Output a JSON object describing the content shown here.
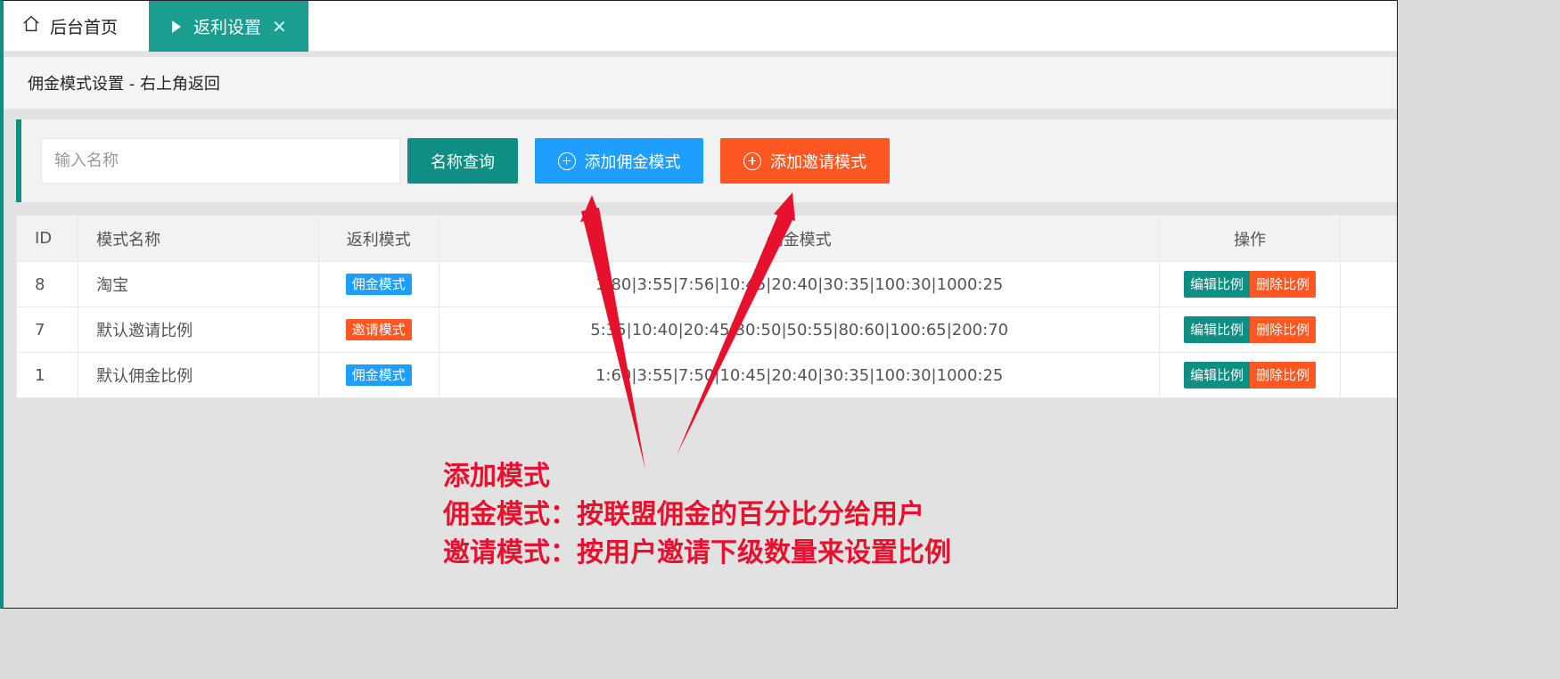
{
  "tabs": {
    "home_label": "后台首页",
    "active_label": "返利设置",
    "close_glyph": "✕"
  },
  "breadcrumb": "佣金模式设置 - 右上角返回",
  "toolbar": {
    "search_placeholder": "输入名称",
    "query_button": "名称查询",
    "add_commission_button": "添加佣金模式",
    "add_invite_button": "添加邀请模式"
  },
  "table": {
    "headers": [
      "ID",
      "模式名称",
      "返利模式",
      "佣金模式",
      "操作"
    ],
    "rows": [
      {
        "id": "8",
        "name": "淘宝",
        "mode": "佣金模式",
        "mode_color": "#1e9fff",
        "commission": "1:80|3:55|7:56|10:45|20:40|30:35|100:30|1000:25"
      },
      {
        "id": "7",
        "name": "默认邀请比例",
        "mode": "邀请模式",
        "mode_color": "#ff5722",
        "commission": "5:35|10:40|20:45|30:50|50:55|80:60|100:65|200:70"
      },
      {
        "id": "1",
        "name": "默认佣金比例",
        "mode": "佣金模式",
        "mode_color": "#1e9fff",
        "commission": "1:60|3:55|7:50|10:45|20:40|30:35|100:30|1000:25"
      }
    ],
    "edit_label": "编辑比例",
    "delete_label": "删除比例"
  },
  "annotation": {
    "line1": "添加模式",
    "line2": "佣金模式：按联盟佣金的百分比分给用户",
    "line3": "邀请模式：按用户邀请下级数量来设置比例",
    "color": "#e8112d"
  },
  "colors": {
    "teal": "#0f8f84",
    "tab_active": "#1a9e8f",
    "blue": "#1e9fff",
    "orange": "#ff5722"
  }
}
